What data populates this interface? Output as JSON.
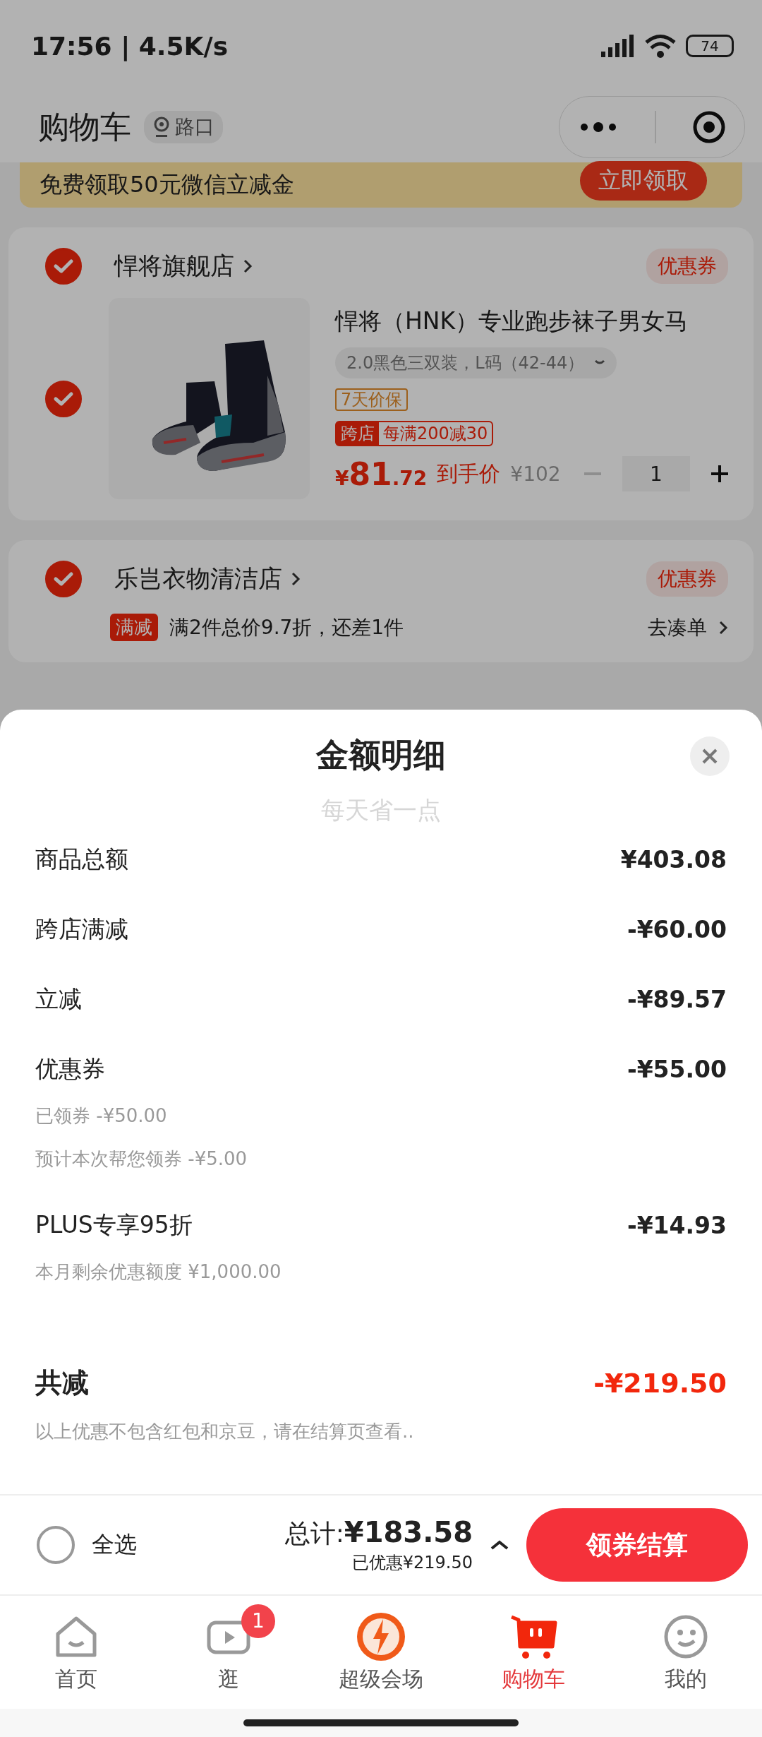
{
  "status_bar": {
    "time": "17:56 | 4.5K/s",
    "battery": "74"
  },
  "header": {
    "title": "购物车",
    "location": "路口"
  },
  "promo_banner": {
    "text": "免费领取50元微信立减金",
    "button": "立即领取"
  },
  "stores": [
    {
      "name": "悍将旗舰店",
      "checked": true,
      "coupon": "优惠券",
      "products": [
        {
          "checked": true,
          "title": "悍将（HNK）专业跑步袜子男女马",
          "spec": "2.0黑色三双装，L码（42-44）",
          "guarantee": "7天价保",
          "promo_tag": "跨店",
          "promo_text": "每满200减30",
          "currency": "¥",
          "price_int": "81",
          "price_dec": ".72",
          "price_label": "到手价",
          "original_price": "¥102",
          "quantity": "1"
        }
      ]
    },
    {
      "name": "乐岂衣物清洁店",
      "checked": true,
      "coupon": "优惠券",
      "deal": {
        "tag": "满减",
        "text": "满2件总价9.7折，还差1件",
        "link": "去凑单"
      }
    }
  ],
  "sheet": {
    "title": "金额明细",
    "subtitle": "每天省一点",
    "rows": [
      {
        "label": "商品总额",
        "value": "¥403.08",
        "notes": []
      },
      {
        "label": "跨店满减",
        "value": "-¥60.00",
        "notes": []
      },
      {
        "label": "立减",
        "value": "-¥89.57",
        "notes": []
      },
      {
        "label": "优惠券",
        "value": "-¥55.00",
        "notes": [
          "已领券 -¥50.00",
          "预计本次帮您领券 -¥5.00"
        ]
      },
      {
        "label": "PLUS专享95折",
        "value": "-¥14.93",
        "notes": [
          "本月剩余优惠额度 ¥1,000.00"
        ]
      }
    ],
    "total": {
      "label": "共减",
      "value": "-¥219.50",
      "note": "以上优惠不包含红包和京豆，请在结算页查看.."
    }
  },
  "checkout": {
    "select_all": "全选",
    "select_all_checked": false,
    "total_label": "总计:",
    "total": "¥183.58",
    "saved": "已优惠¥219.50",
    "button": "领券结算"
  },
  "tabs": [
    {
      "label": "首页",
      "selected": false
    },
    {
      "label": "逛",
      "selected": false,
      "badge": "1"
    },
    {
      "label": "超级会场",
      "selected": false
    },
    {
      "label": "购物车",
      "selected": true
    },
    {
      "label": "我的",
      "selected": false
    }
  ]
}
